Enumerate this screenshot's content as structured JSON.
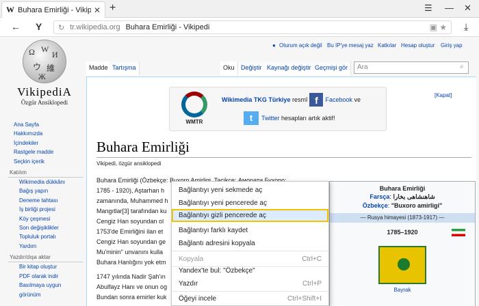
{
  "browser": {
    "tab_title": "Buhara Emirliği - Vikipedi",
    "url_domain": "tr.wikipedia.org",
    "url_page_title": "Buhara Emirliği - Vikipedi"
  },
  "logo": {
    "wordmark": "VikipediA",
    "subtitle": "Özgür Ansiklopedi"
  },
  "sidebar": {
    "nav": [
      "Ana Sayfa",
      "Hakkımızda",
      "İçindekiler",
      "Rastgele madde",
      "Seçkin içerik"
    ],
    "katilim_heading": "Katılım",
    "katilim": [
      "Wikimedia dükkânı",
      "Bağış yapın",
      "Deneme tahtası",
      "İş birliği projesi",
      "Köy çeşmesi",
      "Son değişiklikler",
      "Topluluk portalı",
      "Yardım"
    ],
    "print_heading": "Yazdır/dışa aktar",
    "print": [
      "Bir kitap oluştur",
      "PDF olarak indir",
      "Basılmaya uygun",
      "görünüm"
    ]
  },
  "personal": {
    "not_logged": "Oturum açık değil",
    "talk": "Bu IP'ye mesaj yaz",
    "contribs": "Katkılar",
    "create": "Hesap oluştur",
    "login": "Giriş yap"
  },
  "tabs": {
    "article": "Madde",
    "talk": "Tartışma",
    "read": "Oku",
    "edit": "Değiştir",
    "edit_source": "Kaynağı değiştir",
    "history": "Geçmişi gör"
  },
  "search": {
    "placeholder": "Ara"
  },
  "banner": {
    "close": "[Kapat]",
    "wmtr": "WMTR",
    "org": "Wikimedia TKG Türkiye",
    "text1": "resmî",
    "facebook": "Facebook",
    "and": "ve",
    "twitter": "Twitter",
    "text2": "hesapları artık aktif!"
  },
  "article": {
    "title": "Buhara Emirliği",
    "tagline": "Vikipedi, özgür ansiklopedi",
    "lines": [
      "Buhara Emirliği (Özbekçe: Buxoro Amirligi, Tacikçe: Аморати Бухоро;",
      "1785 - 1920), Aştarhan h",
      "zamanında, Muhammed h",
      "Mangıtlar[3] tarafından ku",
      "Cengiz Han soyundan ol",
      "1753'de Emirliğini ilan et",
      "Cengiz Han soyundan ge",
      "Mu'minin\" unvanını kulla",
      "Buhara Hanlığını yok etm",
      "1747 yılında Nadir Şah'ın",
      "Abulfayz Hanı ve onun og",
      "Bundan sonra emirler kuk"
    ]
  },
  "infobox": {
    "title": "Buhara Emirliği",
    "farsca_label": "Farsça",
    "farsca_value": "شاهنشاهی بخارا",
    "ozbek_label": "Özbekçe",
    "ozbek_value": "\"Buxoro amirligi\"",
    "bar": "— Rusya himayesi (1873-1917) —",
    "years": "1785–1920",
    "caption": "Bayrak"
  },
  "context_menu": {
    "items": [
      {
        "label": "Bağlantıyı yeni sekmede aç",
        "shortcut": "",
        "highlighted": false,
        "disabled": false
      },
      {
        "label": "Bağlantıyı yeni pencerede aç",
        "shortcut": "",
        "highlighted": false,
        "disabled": false
      },
      {
        "label": "Bağlantıyı gizli pencerede aç",
        "shortcut": "",
        "highlighted": true,
        "disabled": false
      },
      {
        "label": "Bağlantıyı farklı kaydet",
        "shortcut": "",
        "highlighted": false,
        "disabled": false
      },
      {
        "label": "Bağlantı adresini kopyala",
        "shortcut": "",
        "highlighted": false,
        "disabled": false
      },
      {
        "label": "Kopyala",
        "shortcut": "Ctrl+C",
        "highlighted": false,
        "disabled": true
      },
      {
        "label": "Yandex'te bul: \"Özbekçe\"",
        "shortcut": "",
        "highlighted": false,
        "disabled": false
      },
      {
        "label": "Yazdır",
        "shortcut": "Ctrl+P",
        "highlighted": false,
        "disabled": false
      },
      {
        "label": "Öğeyi incele",
        "shortcut": "Ctrl+Shift+I",
        "highlighted": false,
        "disabled": false
      }
    ]
  },
  "colors": {
    "link": "#0645ad",
    "highlight_bg": "#dcecff",
    "highlight_border": "#f2c200"
  }
}
